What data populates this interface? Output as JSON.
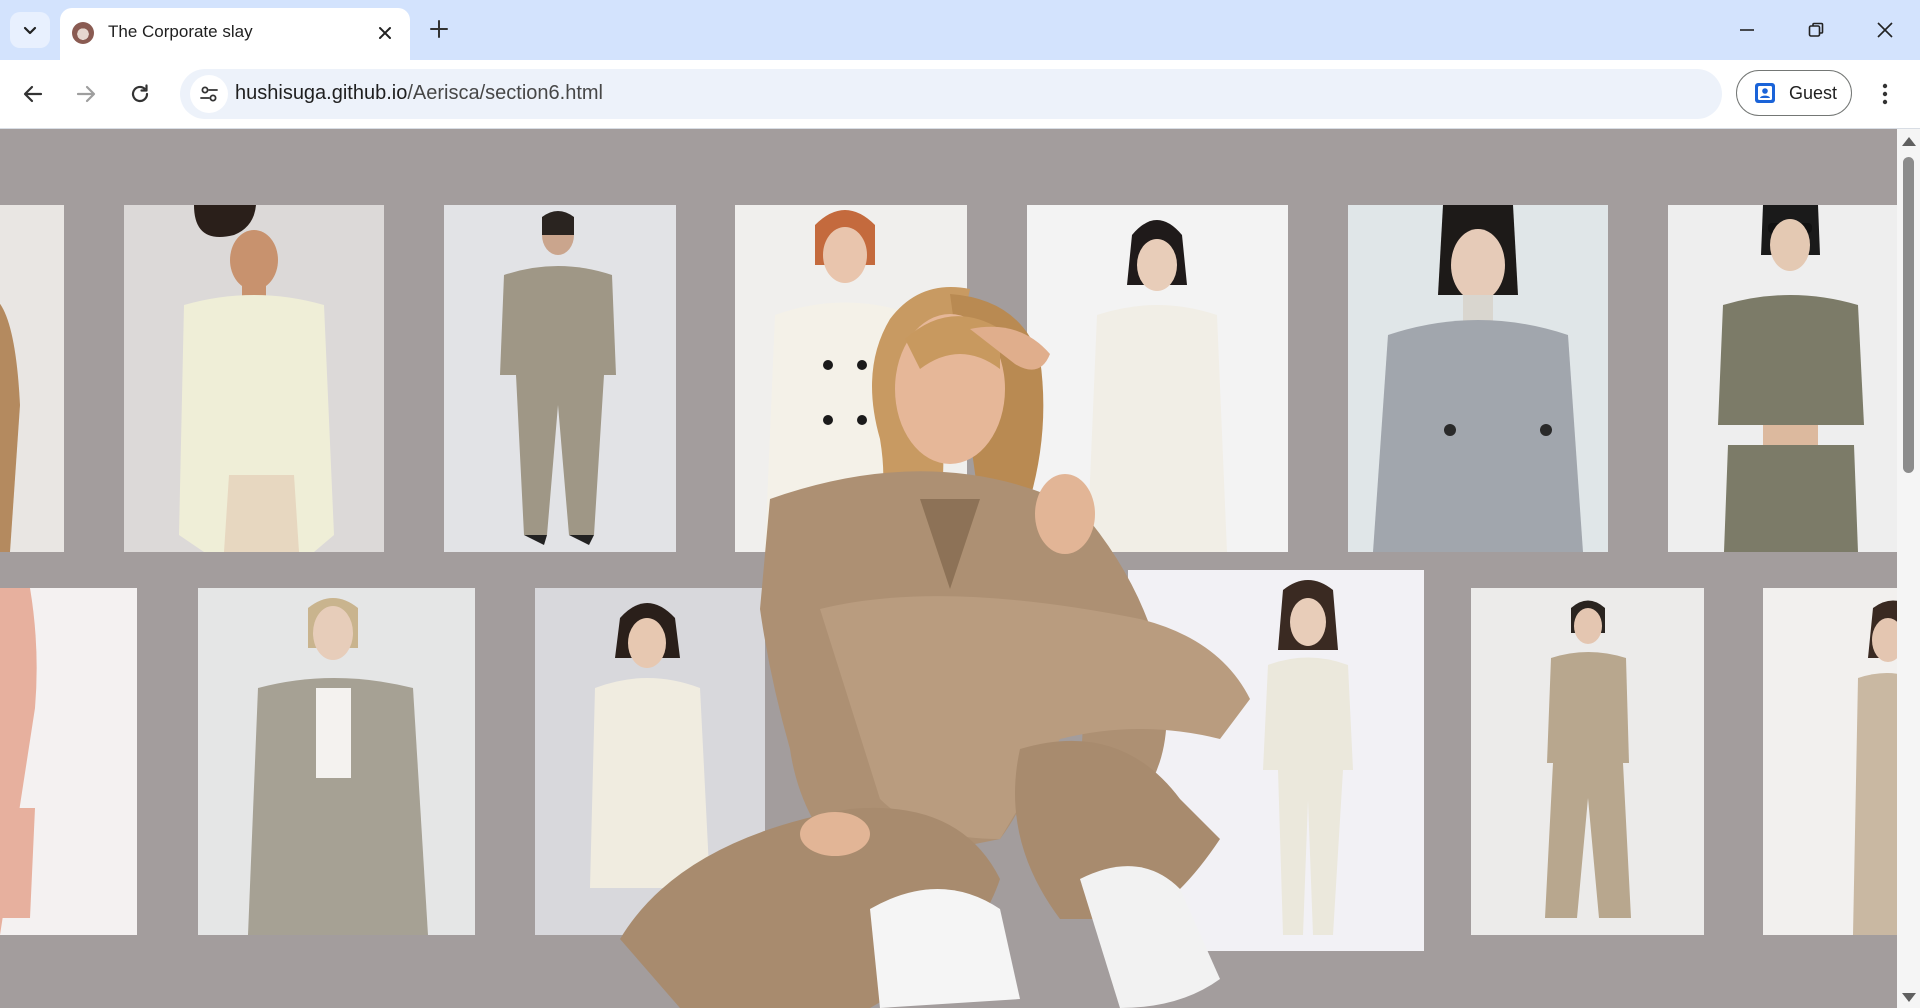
{
  "browser": {
    "tab_title": "The Corporate slay",
    "url_host": "hushisuga.github.io",
    "url_path": "/Aerisca/section6.html",
    "profile_label": "Guest",
    "icons": {
      "tab_search": "chevron-down-icon",
      "tab_close": "close-icon",
      "new_tab": "plus-icon",
      "minimize": "minimize-icon",
      "restore": "restore-icon",
      "close_window": "close-icon",
      "back": "arrow-left-icon",
      "forward": "arrow-right-icon",
      "reload": "reload-icon",
      "site_info": "tune-icon",
      "profile": "person-badge-icon",
      "menu": "kebab-menu-icon"
    }
  },
  "page": {
    "background_color": "#a39d9d",
    "hero": {
      "description_name": "woman-in-beige-oversized-suit"
    },
    "gallery_row_1": [
      {
        "name": "camel-blazer-model",
        "bg": "#e9e6e3",
        "garment": "#b48a5f"
      },
      {
        "name": "cream-wrap-blazer-model",
        "bg": "#dcd9d8",
        "garment": "#efeed7"
      },
      {
        "name": "taupe-double-breasted-set-model",
        "bg": "#e2e3e6",
        "garment": "#9f9786"
      },
      {
        "name": "white-double-breasted-blazer-model",
        "bg": "#f0efed",
        "garment": "#f4f1e8"
      },
      {
        "name": "cream-blazer-model",
        "bg": "#f3f3f3",
        "garment": "#f1eee6"
      },
      {
        "name": "grey-cropped-blazer-model",
        "bg": "#e0e6e8",
        "garment": "#a1a6ad"
      },
      {
        "name": "olive-cropped-blazer-model",
        "bg": "#eeeeee",
        "garment": "#7c7b68"
      }
    ],
    "gallery_row_2": [
      {
        "name": "pink-suit-model",
        "bg": "#f4f1f1",
        "garment": "#e7b09e"
      },
      {
        "name": "grey-blazer-model",
        "bg": "#e5e6e6",
        "garment": "#a6a194"
      },
      {
        "name": "ivory-blazer-model",
        "bg": "#d8d8dc",
        "garment": "#f0ece0"
      },
      {
        "name": "ivory-suit-model",
        "bg": "#f2f1f5",
        "garment": "#ebe8dc"
      },
      {
        "name": "beige-belted-suit-model",
        "bg": "#ecebea",
        "garment": "#b8a78e"
      },
      {
        "name": "beige-blazer-model",
        "bg": "#f2f0ee",
        "garment": "#c9b8a2"
      }
    ]
  }
}
